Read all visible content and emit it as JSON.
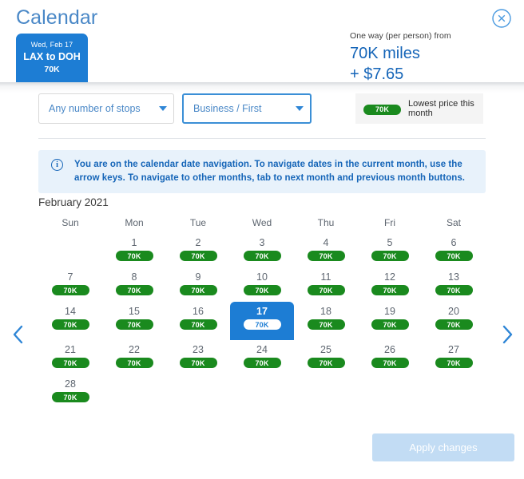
{
  "header": {
    "title": "Calendar",
    "close_icon": "close-circle-icon",
    "flight_card": {
      "date": "Wed, Feb 17",
      "route": "LAX to DOH",
      "miles": "70K"
    },
    "price": {
      "label": "One way (per person) from",
      "miles": "70K miles",
      "fee": "+ $7.65"
    }
  },
  "filters": {
    "stops": {
      "value": "Any number of stops",
      "caret_icon": "chevron-down-icon"
    },
    "cabin": {
      "value": "Business / First",
      "caret_icon": "chevron-down-icon"
    },
    "legend": {
      "badge": "70K",
      "text": "Lowest price this month"
    }
  },
  "info_banner": {
    "icon": "info-icon",
    "text": "You are on the calendar date navigation. To navigate dates in the current month, use the arrow keys. To navigate to other months, tab to next month and previous month buttons."
  },
  "calendar": {
    "month_label": "February 2021",
    "day_headers": [
      "Sun",
      "Mon",
      "Tue",
      "Wed",
      "Thu",
      "Fri",
      "Sat"
    ],
    "prev_icon": "chevron-left-icon",
    "next_icon": "chevron-right-icon",
    "selected_day": 17,
    "weeks": [
      [
        null,
        1,
        2,
        3,
        4,
        5,
        6
      ],
      [
        7,
        8,
        9,
        10,
        11,
        12,
        13
      ],
      [
        14,
        15,
        16,
        17,
        18,
        19,
        20
      ],
      [
        21,
        22,
        23,
        24,
        25,
        26,
        27
      ],
      [
        28,
        null,
        null,
        null,
        null,
        null,
        null
      ]
    ],
    "prices": {
      "1": "70K",
      "2": "70K",
      "3": "70K",
      "4": "70K",
      "5": "70K",
      "6": "70K",
      "7": "70K",
      "8": "70K",
      "9": "70K",
      "10": "70K",
      "11": "70K",
      "12": "70K",
      "13": "70K",
      "14": "70K",
      "15": "70K",
      "16": "70K",
      "17": "70K",
      "18": "70K",
      "19": "70K",
      "20": "70K",
      "21": "70K",
      "22": "70K",
      "23": "70K",
      "24": "70K",
      "25": "70K",
      "26": "70K",
      "27": "70K",
      "28": "70K"
    }
  },
  "footer": {
    "apply_label": "Apply changes"
  },
  "colors": {
    "brand_blue": "#1d7dd4",
    "title_blue": "#4a88c7",
    "link_blue": "#1565b8",
    "price_green": "#1a8a1e",
    "banner_bg": "#e8f2fb",
    "legend_bg": "#f4f4f4",
    "disabled_btn": "#c2dcf4"
  }
}
